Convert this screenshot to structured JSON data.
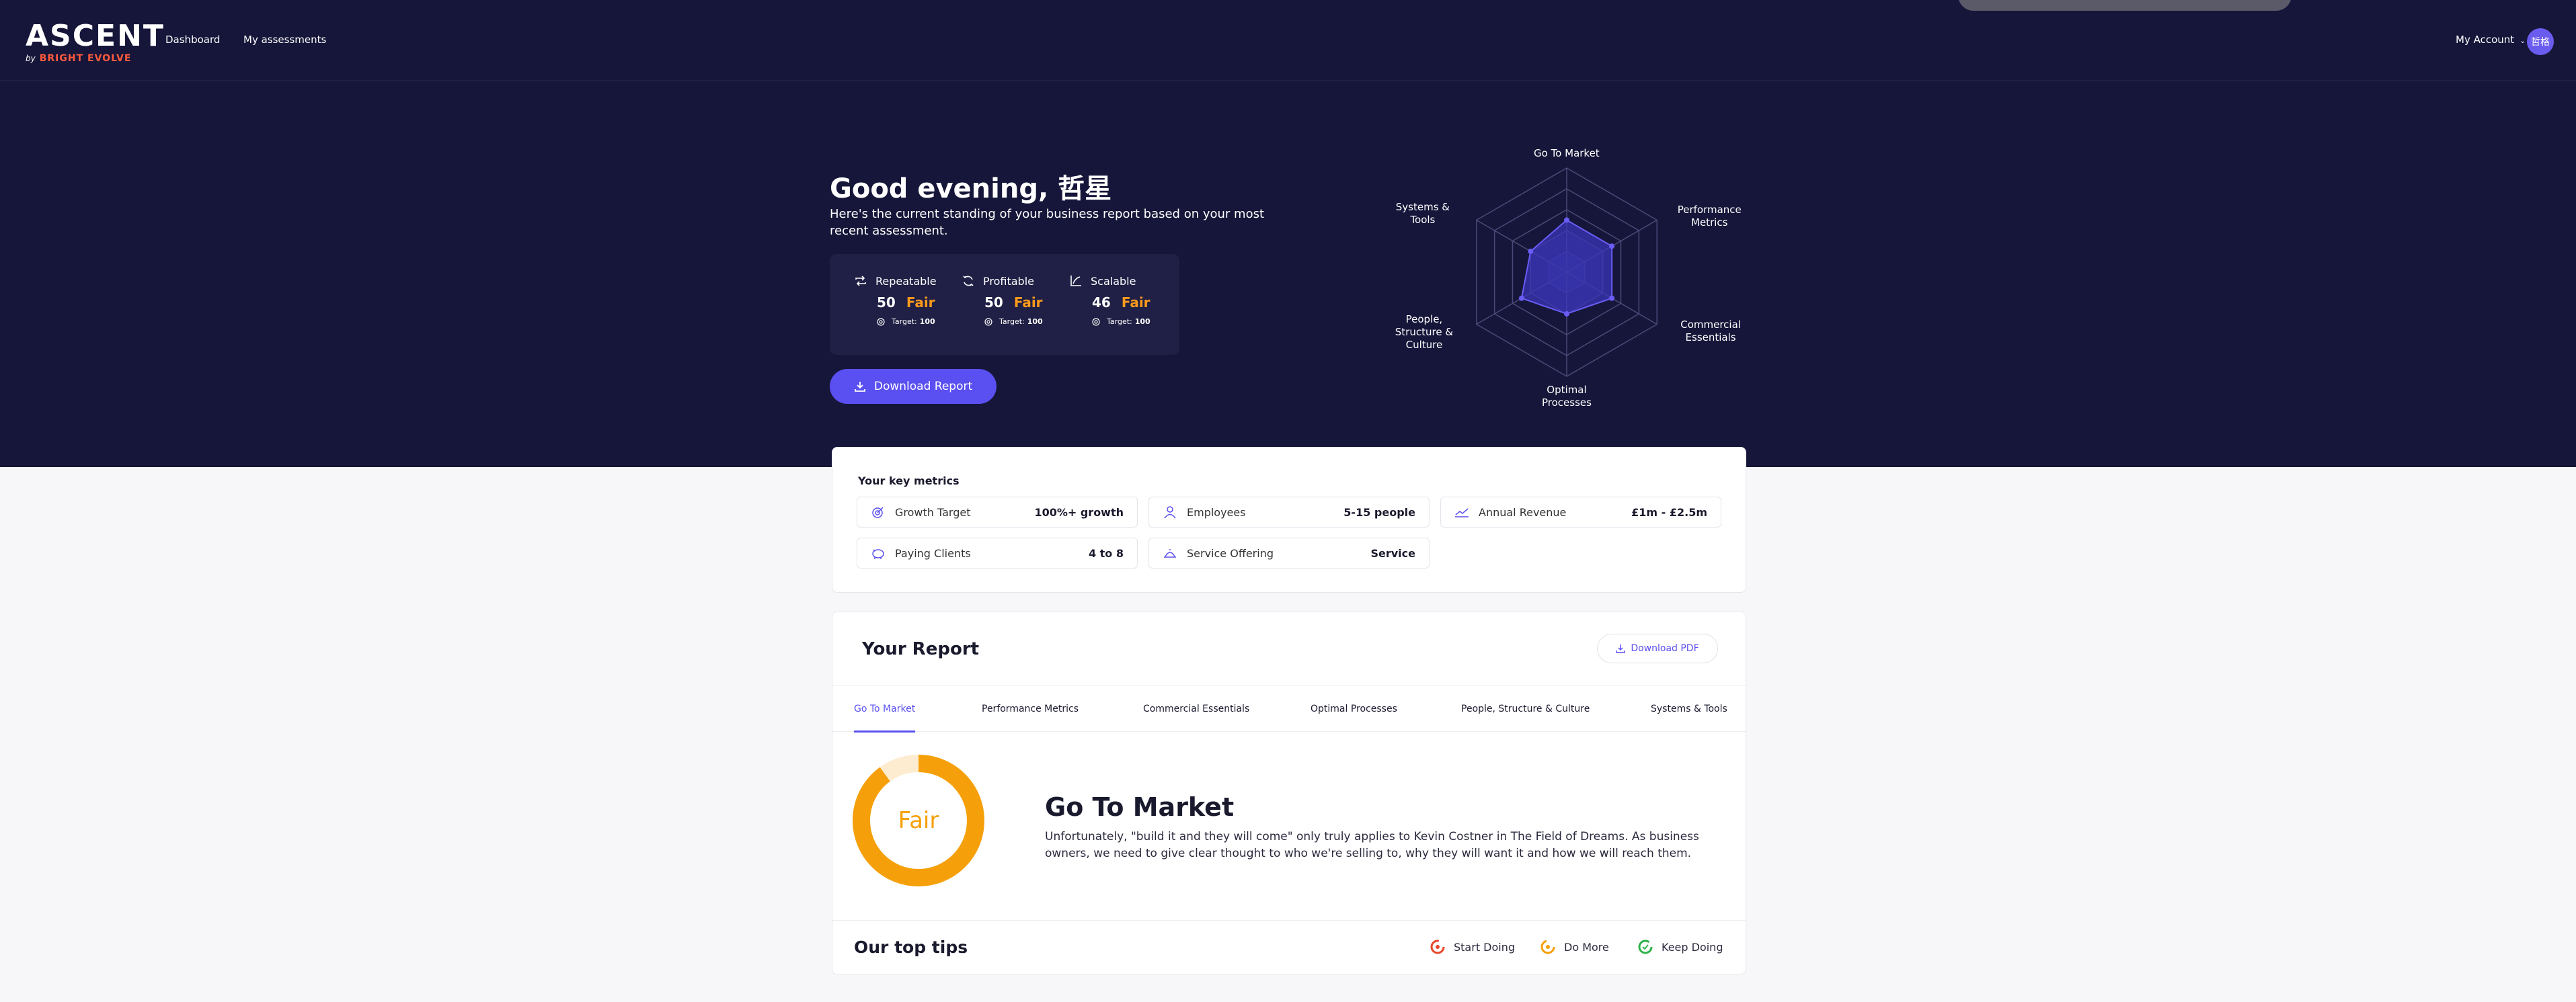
{
  "header": {
    "logo": "ASCENT",
    "logo_by": "by",
    "logo_brand": "BRIGHT EVOLVE",
    "nav": [
      "Dashboard",
      "My assessments"
    ],
    "account_label": "My Account",
    "avatar_initials": "哲格"
  },
  "hero": {
    "greeting": "Good evening, 哲星",
    "subtitle": "Here's the current standing of your business report based on your most recent assessment.",
    "stats": [
      {
        "icon": "repeat-icon",
        "label": "Repeatable",
        "score": "50",
        "rating": "Fair",
        "target_label": "Target:",
        "target_value": "100"
      },
      {
        "icon": "profit-cycle-icon",
        "label": "Profitable",
        "score": "50",
        "rating": "Fair",
        "target_label": "Target:",
        "target_value": "100"
      },
      {
        "icon": "chart-axis-icon",
        "label": "Scalable",
        "score": "46",
        "rating": "Fair",
        "target_label": "Target:",
        "target_value": "100"
      }
    ],
    "download_label": "Download Report"
  },
  "chart_data": {
    "type": "radar",
    "axes": [
      "Go To Market",
      "Performance Metrics",
      "Commercial Essentials",
      "Optimal Processes",
      "People, Structure & Culture",
      "Systems & Tools"
    ],
    "axis_labels_display": [
      "Go To Market",
      "Performance\nMetrics",
      "Commercial\nEssentials",
      "Optimal\nProcesses",
      "People,\nStructure &\nCulture",
      "Systems &\nTools"
    ],
    "rings": 5,
    "max": 100,
    "values": [
      50,
      50,
      50,
      40,
      50,
      40
    ],
    "colors": {
      "grid": "#4a4a78",
      "fill": "#3b36b8",
      "point": "#6a5cf5"
    }
  },
  "metrics": {
    "title": "Your key metrics",
    "items": [
      {
        "icon": "target-icon",
        "label": "Growth Target",
        "value": "100%+ growth"
      },
      {
        "icon": "employees-icon",
        "label": "Employees",
        "value": "5-15 people"
      },
      {
        "icon": "revenue-icon",
        "label": "Annual Revenue",
        "value": "£1m - £2.5m"
      },
      {
        "icon": "piggy-bank-icon",
        "label": "Paying Clients",
        "value": "4 to 8"
      },
      {
        "icon": "service-icon",
        "label": "Service Offering",
        "value": "Service"
      }
    ]
  },
  "report": {
    "title": "Your Report",
    "pdf_label": "Download PDF",
    "tabs": [
      "Go To Market",
      "Performance Metrics",
      "Commercial Essentials",
      "Optimal Processes",
      "People, Structure & Culture",
      "Systems & Tools"
    ],
    "active_tab": 0,
    "rating": "Fair",
    "rating_fraction": 0.9,
    "section_title": "Go To Market",
    "section_desc": "Unfortunately, \"build it and they will come\" only truly applies to Kevin Costner in The Field of Dreams. As business owners, we need to give clear thought to who we're selling to, why they will want it and how we will reach them.",
    "tips_title": "Our top tips",
    "tips": [
      {
        "label": "Start Doing",
        "color": "#e8472a"
      },
      {
        "label": "Do More",
        "color": "#f5a00a"
      },
      {
        "label": "Keep Doing",
        "color": "#2fb24a"
      }
    ]
  },
  "colors": {
    "accent": "#5a4ff0",
    "navy": "#16163a",
    "fair": "#ff9a1a"
  }
}
